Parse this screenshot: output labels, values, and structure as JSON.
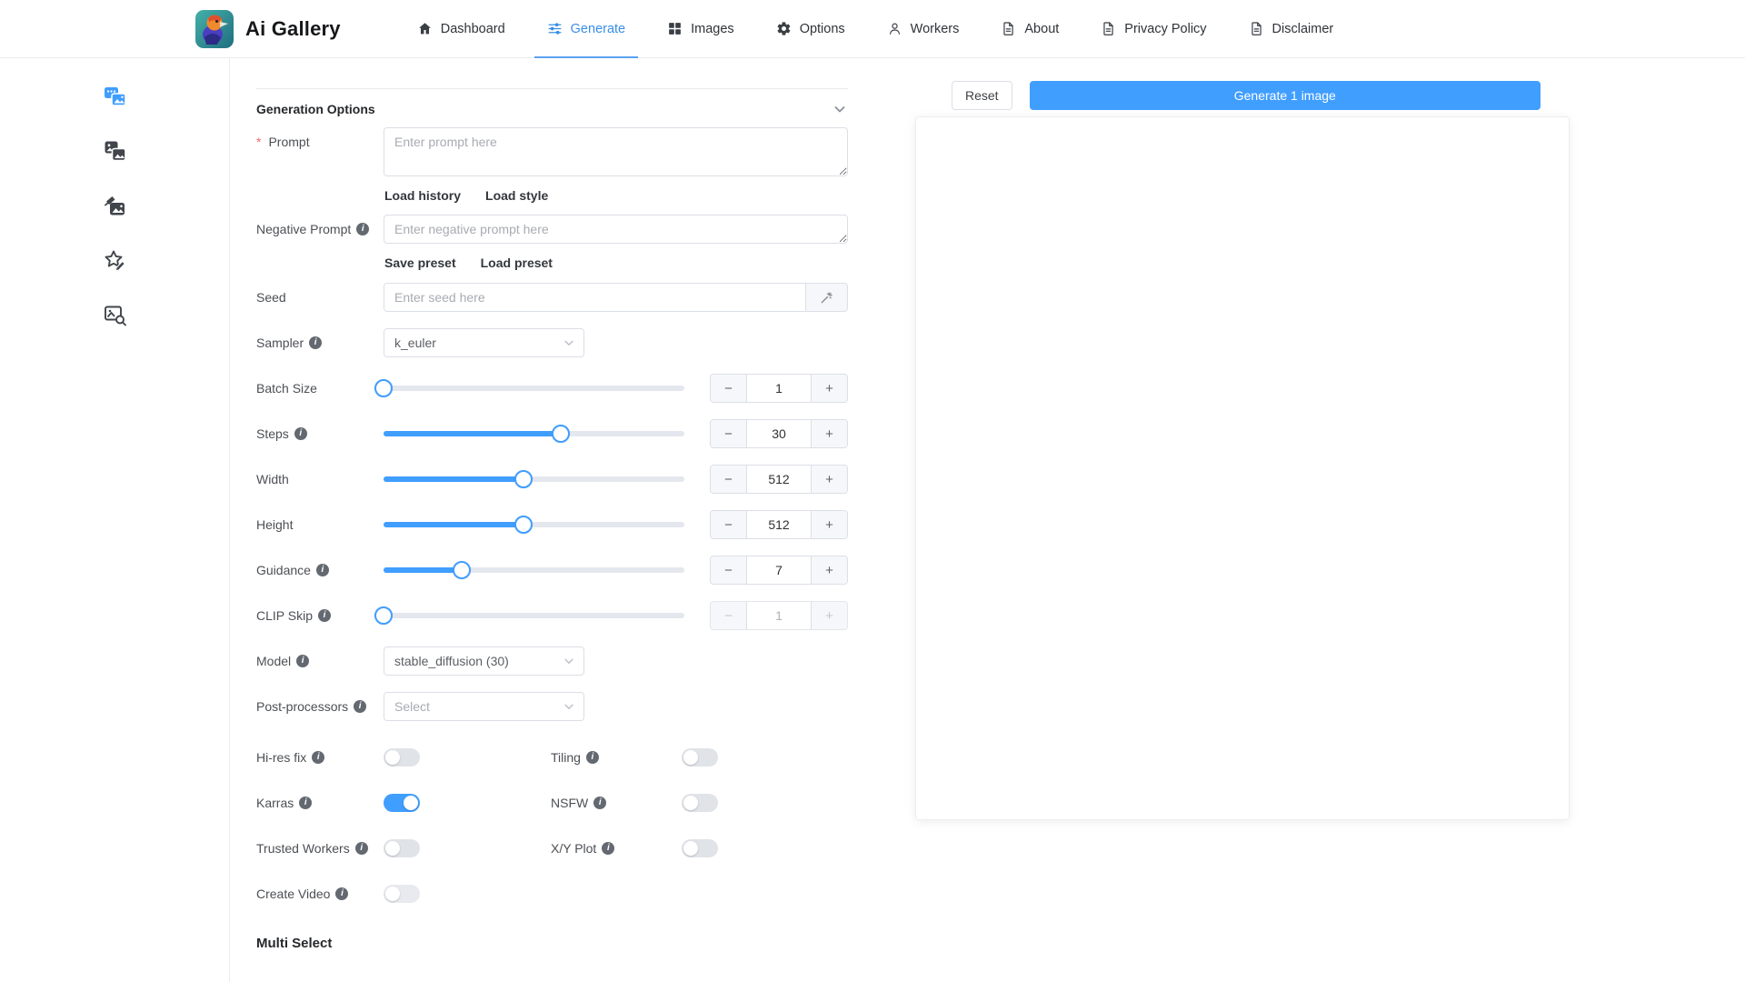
{
  "header": {
    "app_title": "Ai Gallery",
    "nav": [
      {
        "label": "Dashboard",
        "icon": "home-icon",
        "active": false
      },
      {
        "label": "Generate",
        "icon": "sliders-icon",
        "active": true
      },
      {
        "label": "Images",
        "icon": "grid-icon",
        "active": false
      },
      {
        "label": "Options",
        "icon": "gear-icon",
        "active": false
      },
      {
        "label": "Workers",
        "icon": "user-icon",
        "active": false
      },
      {
        "label": "About",
        "icon": "document-icon",
        "active": false
      },
      {
        "label": "Privacy Policy",
        "icon": "document-icon",
        "active": false
      },
      {
        "label": "Disclaimer",
        "icon": "document-icon",
        "active": false
      }
    ]
  },
  "sidebar": {
    "items": [
      {
        "name": "text-to-image-icon",
        "active": true
      },
      {
        "name": "image-to-image-icon",
        "active": false
      },
      {
        "name": "inpainting-icon",
        "active": false
      },
      {
        "name": "rate-images-icon",
        "active": false
      },
      {
        "name": "interrogate-icon",
        "active": false
      }
    ]
  },
  "form": {
    "section_title": "Generation Options",
    "prompt": {
      "label": "Prompt",
      "placeholder": "Enter prompt here",
      "links": {
        "history": "Load history",
        "style": "Load style"
      }
    },
    "negative_prompt": {
      "label": "Negative Prompt",
      "placeholder": "Enter negative prompt here",
      "links": {
        "save": "Save preset",
        "load": "Load preset"
      }
    },
    "seed": {
      "label": "Seed",
      "placeholder": "Enter seed here",
      "addon_icon": "magic-wand-icon"
    },
    "sampler": {
      "label": "Sampler",
      "value": "k_euler"
    },
    "sliders": [
      {
        "label": "Batch Size",
        "value": "1",
        "fill_pct": 0,
        "disabled": false
      },
      {
        "label": "Steps",
        "value": "30",
        "fill_pct": 59,
        "disabled": false
      },
      {
        "label": "Width",
        "value": "512",
        "fill_pct": 46.5,
        "disabled": false
      },
      {
        "label": "Height",
        "value": "512",
        "fill_pct": 46.5,
        "disabled": false
      },
      {
        "label": "Guidance",
        "value": "7",
        "fill_pct": 26,
        "disabled": false
      },
      {
        "label": "CLIP Skip",
        "value": "1",
        "fill_pct": 0,
        "disabled": true
      }
    ],
    "model": {
      "label": "Model",
      "value": "stable_diffusion (30)"
    },
    "post_processors": {
      "label": "Post-processors",
      "placeholder": "Select"
    },
    "toggles": [
      {
        "label": "Hi-res fix",
        "on": false
      },
      {
        "label": "Tiling",
        "on": false
      },
      {
        "label": "Karras",
        "on": true
      },
      {
        "label": "NSFW",
        "on": false
      },
      {
        "label": "Trusted Workers",
        "on": false
      },
      {
        "label": "X/Y Plot",
        "on": false
      },
      {
        "label": "Create Video",
        "on": false
      }
    ],
    "multi_select_heading": "Multi Select"
  },
  "actions": {
    "reset": "Reset",
    "generate": "Generate 1 image"
  },
  "colors": {
    "primary": "#409eff",
    "nav_active": "#3a8ee6",
    "switch_on": "#409eff",
    "slider_fill": "#409eff",
    "required_asterisk": "#f56c6c"
  }
}
